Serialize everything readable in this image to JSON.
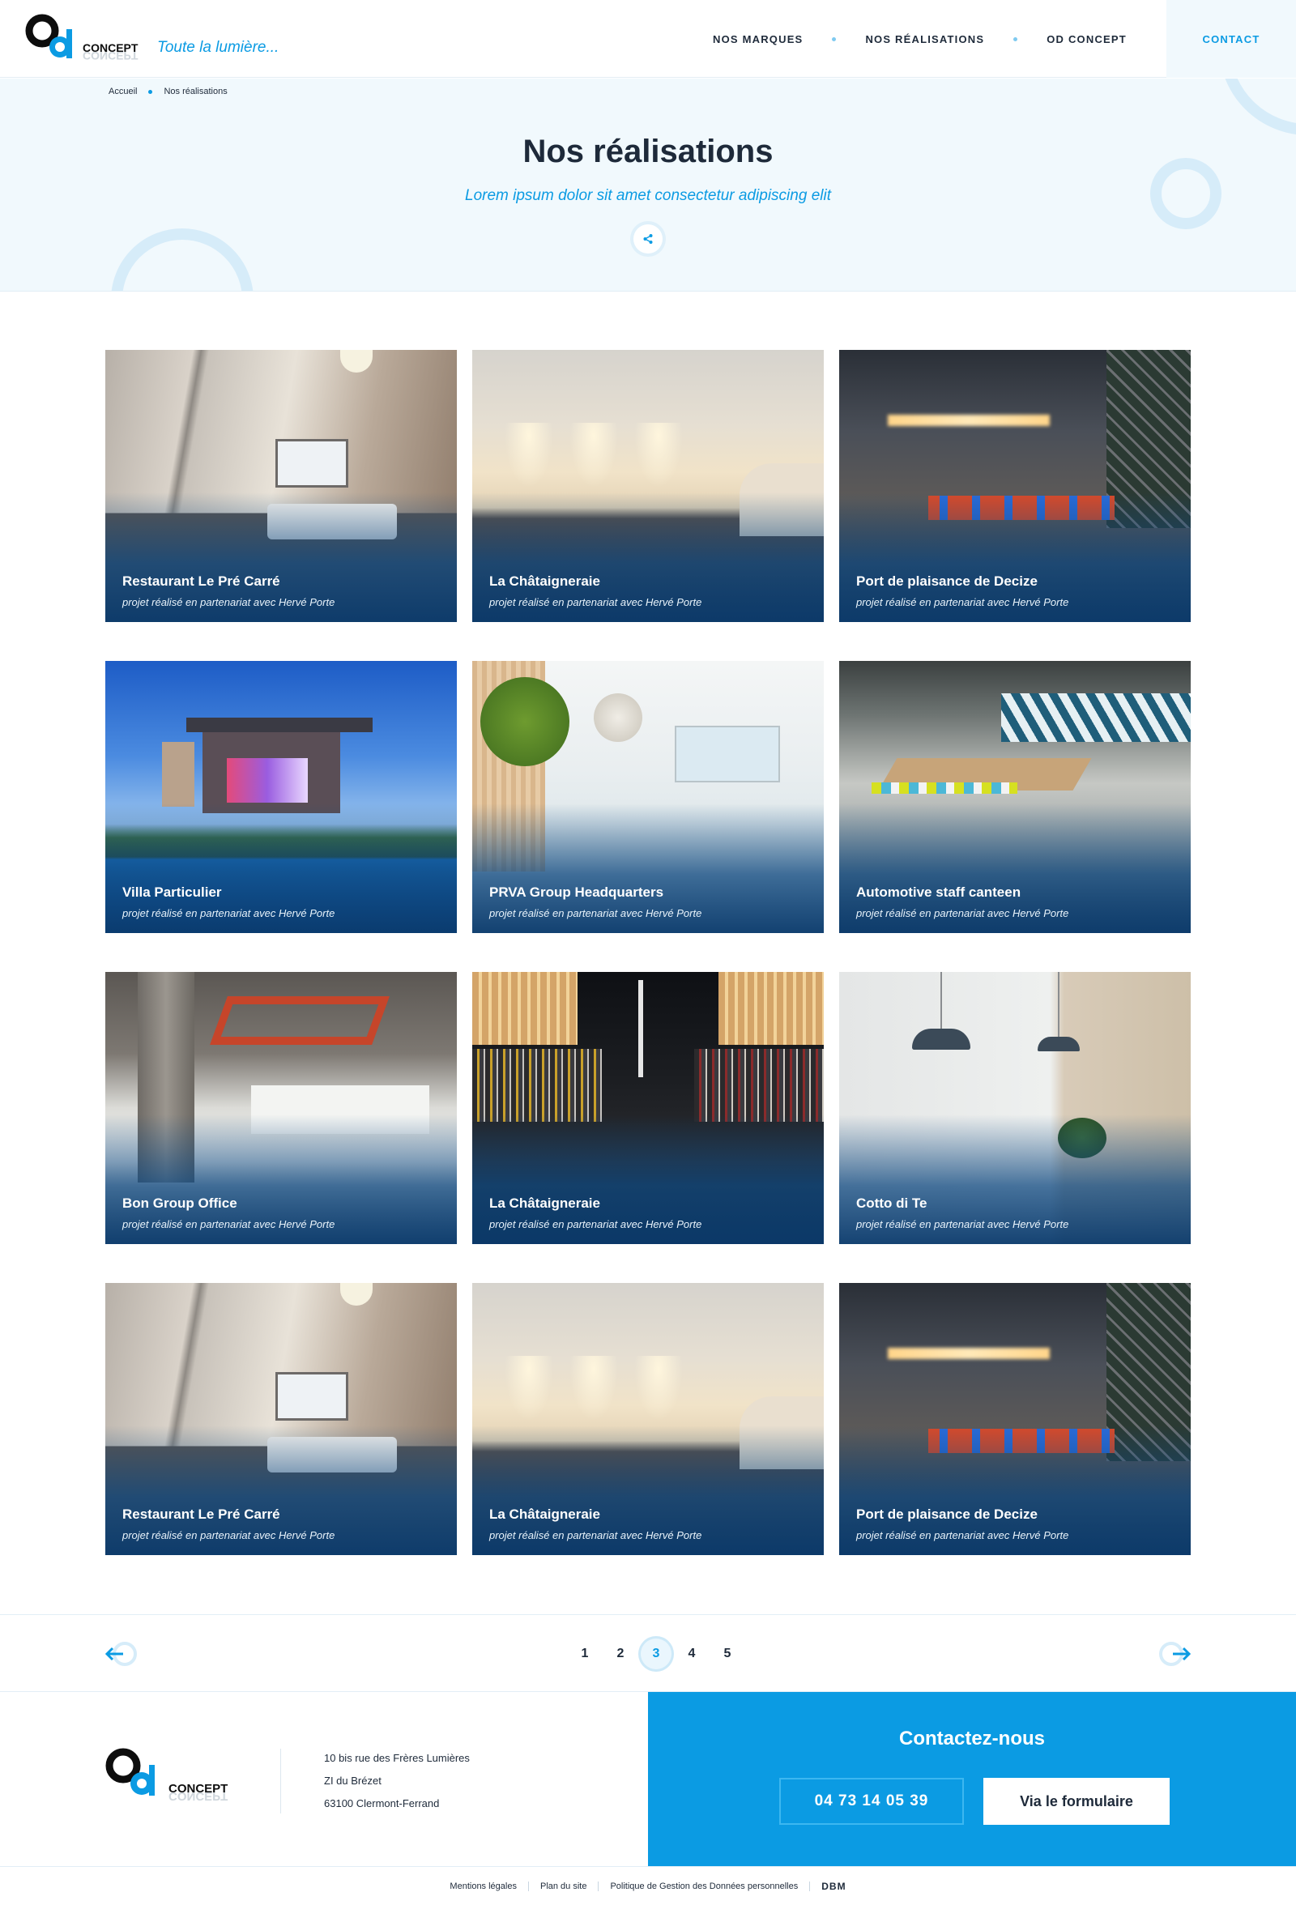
{
  "header": {
    "logo_text": "CONCEPT",
    "tagline": "Toute la lumière...",
    "nav": [
      "NOS MARQUES",
      "NOS RÉALISATIONS",
      "OD CONCEPT"
    ],
    "contact_label": "CONTACT"
  },
  "breadcrumb": {
    "home": "Accueil",
    "current": "Nos réalisations"
  },
  "hero": {
    "title": "Nos réalisations",
    "subtitle": "Lorem ipsum dolor sit amet consectetur adipiscing elit"
  },
  "projects": [
    {
      "title": "Restaurant Le Pré Carré",
      "subtitle": "projet réalisé en partenariat avec Hervé Porte"
    },
    {
      "title": "La Châtaigneraie",
      "subtitle": "projet réalisé en partenariat avec Hervé Porte"
    },
    {
      "title": "Port de plaisance de Decize",
      "subtitle": "projet réalisé en partenariat avec Hervé Porte"
    },
    {
      "title": "Villa Particulier",
      "subtitle": "projet réalisé en partenariat avec Hervé Porte"
    },
    {
      "title": "PRVA Group Headquarters",
      "subtitle": "projet réalisé en partenariat avec Hervé Porte"
    },
    {
      "title": "Automotive staff canteen",
      "subtitle": "projet réalisé en partenariat avec Hervé Porte"
    },
    {
      "title": "Bon Group Office",
      "subtitle": "projet réalisé en partenariat avec Hervé Porte"
    },
    {
      "title": "La Châtaigneraie",
      "subtitle": "projet réalisé en partenariat avec Hervé Porte"
    },
    {
      "title": "Cotto di Te",
      "subtitle": "projet réalisé en partenariat avec Hervé Porte"
    },
    {
      "title": "Restaurant Le Pré Carré",
      "subtitle": "projet réalisé en partenariat avec Hervé Porte"
    },
    {
      "title": "La Châtaigneraie",
      "subtitle": "projet réalisé en partenariat avec Hervé Porte"
    },
    {
      "title": "Port de plaisance de Decize",
      "subtitle": "projet réalisé en partenariat avec Hervé Porte"
    }
  ],
  "pagination": {
    "pages": [
      "1",
      "2",
      "3",
      "4",
      "5"
    ],
    "current": "3"
  },
  "footer": {
    "logo_text": "CONCEPT",
    "address": [
      "10 bis rue des Frères Lumières",
      "ZI du Brézet",
      "63100 Clermont-Ferrand"
    ],
    "contact_title": "Contactez-nous",
    "phone": "04 73 14 05 39",
    "form_label": "Via le formulaire"
  },
  "legal": {
    "links": [
      "Mentions légales",
      "Plan du site",
      "Politique de Gestion des Données personnelles"
    ],
    "brand": "DBM"
  },
  "colors": {
    "accent": "#0b9be3",
    "dark": "#1e2a3a",
    "hero_bg": "#f1f9fd"
  },
  "icons": [
    "share-icon",
    "arrow-left-icon",
    "arrow-right-icon"
  ]
}
